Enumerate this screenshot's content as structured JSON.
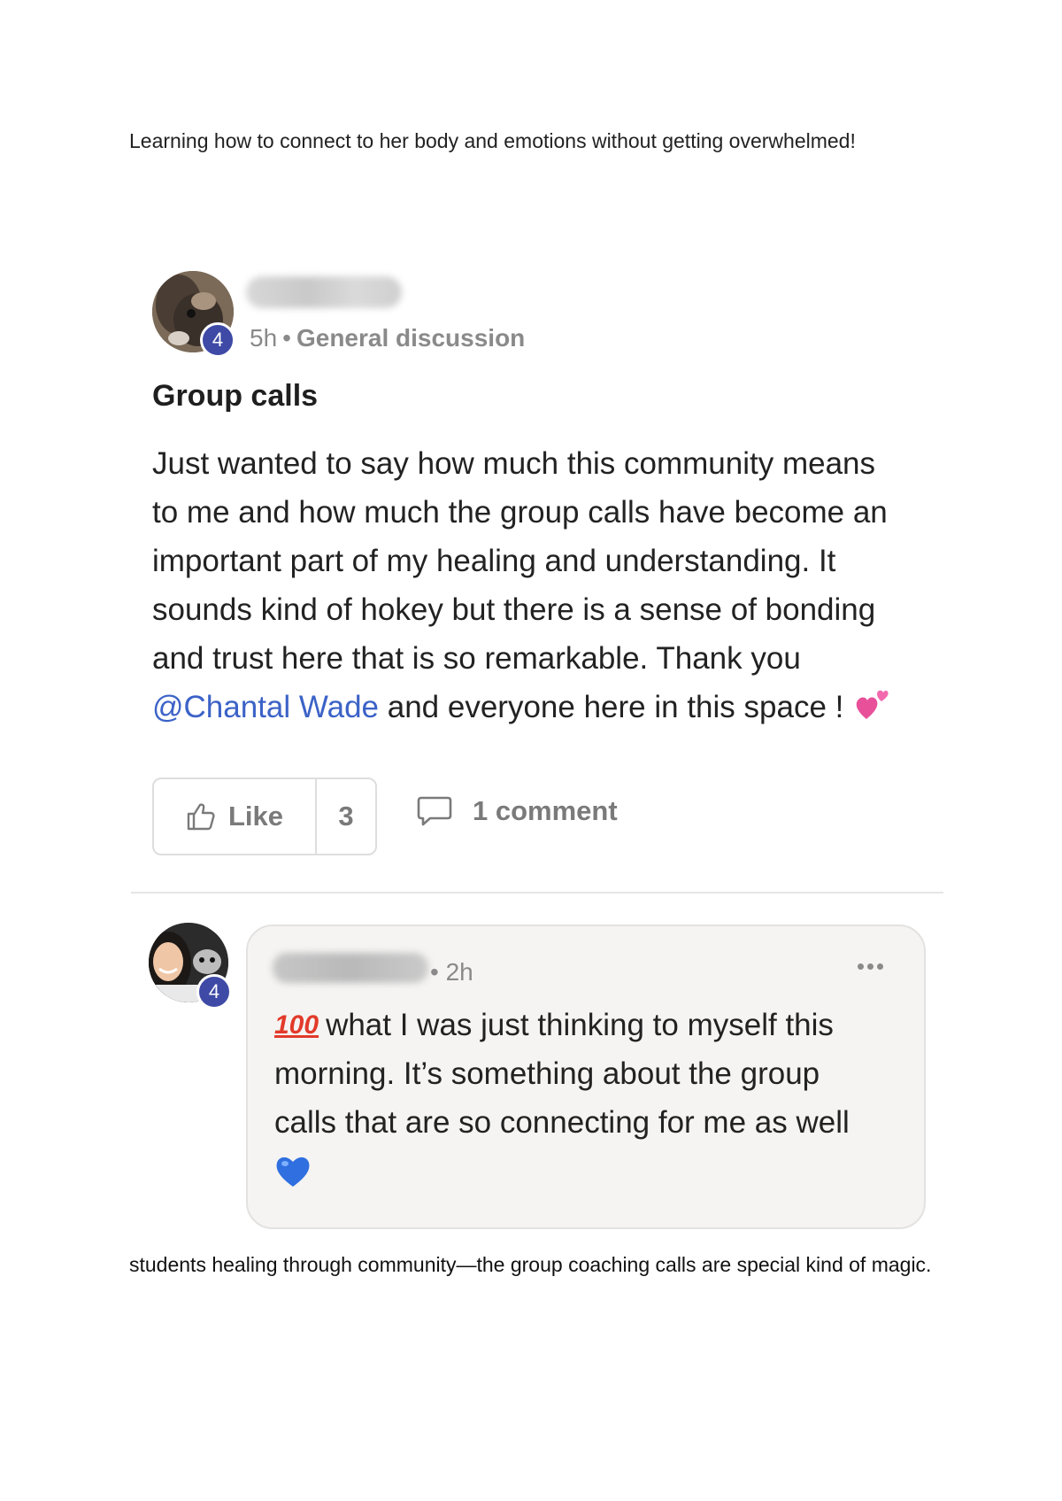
{
  "captions": {
    "top": "Learning how to connect to her body and emotions without getting overwhelmed!",
    "bottom": "students healing through community—the group coaching calls are special kind of magic."
  },
  "post": {
    "level": "4",
    "time": "5h",
    "separator": "•",
    "category": "General discussion",
    "title": "Group calls",
    "body_lines": [
      "Just wanted to say how much this community means",
      "to me and how much the group calls have become an",
      "important part of my healing and understanding. It",
      "sounds kind of hokey but there is a sense of bonding",
      "and trust here that is so remarkable. Thank you"
    ],
    "mention": "@Chantal Wade",
    "body_last": " and everyone here in this space ! ",
    "heart_emoji": "pink-hearts-emoji",
    "like_label": "Like",
    "like_count": "3",
    "comment_label": "1 comment"
  },
  "comment": {
    "level": "4",
    "time": "• 2h",
    "emoji": "100",
    "body_first": "what I was just thinking to myself this",
    "body_lines": [
      "morning. It’s something about the group",
      "calls that are so connecting for me as well"
    ],
    "heart_emoji": "blue-heart-emoji"
  },
  "colors": {
    "badge": "#3e4aa6",
    "mention": "#3b62c7",
    "muted": "#8a8a8a",
    "comment_bg": "#f5f4f2"
  }
}
